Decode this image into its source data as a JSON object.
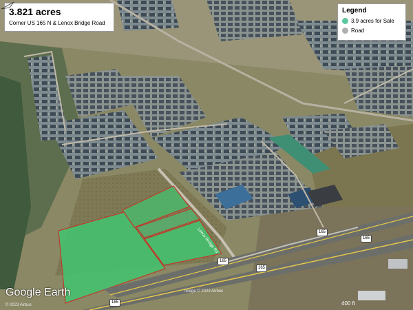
{
  "title_box": {
    "acreage": "3.821 acres",
    "location": "Corner US 165 N & Lenox Bridge Road"
  },
  "legend": {
    "title": "Legend",
    "items": [
      {
        "label": "3.9 acres for Sale",
        "color": "#5cc8a0",
        "icon": "green-circle-icon"
      },
      {
        "label": "Road",
        "color": "#b0b0b0",
        "icon": "gray-circle-icon"
      }
    ]
  },
  "highway_shields": [
    "165",
    "165",
    "165",
    "165",
    "165"
  ],
  "road_label": "Lenox Bridge Rd",
  "branding": {
    "logo": "Google Earth",
    "copyright_left": "© 2023 Airbus",
    "copyright_center": "Image © 2023 Airbus"
  },
  "scale_label": "400 ft",
  "colors": {
    "parcel_fill": "#44c26e",
    "parcel_border": "#c0392b",
    "highway_line": "#e6c84a"
  }
}
